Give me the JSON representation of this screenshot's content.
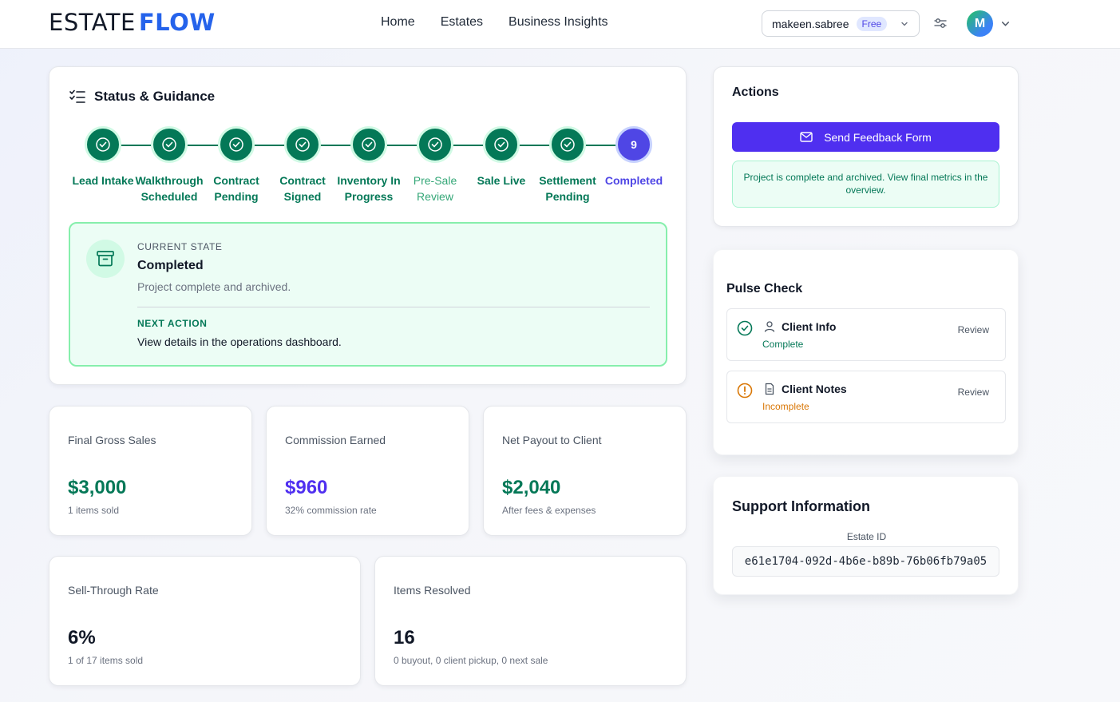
{
  "header": {
    "logo_part1": "ESTATE",
    "logo_part2": "FLOW",
    "nav": [
      "Home",
      "Estates",
      "Business Insights"
    ],
    "username": "makeen.sabree",
    "plan_badge": "Free",
    "avatar_initial": "M"
  },
  "status": {
    "title": "Status & Guidance",
    "steps": [
      {
        "label": "Lead Intake",
        "state": "done"
      },
      {
        "label": "Walkthrough Scheduled",
        "state": "done"
      },
      {
        "label": "Contract Pending",
        "state": "done"
      },
      {
        "label": "Contract Signed",
        "state": "done"
      },
      {
        "label": "Inventory In Progress",
        "state": "done"
      },
      {
        "label": "Pre-Sale Review",
        "state": "done-light"
      },
      {
        "label": "Sale Live",
        "state": "done"
      },
      {
        "label": "Settlement Pending",
        "state": "done"
      },
      {
        "label": "Completed",
        "state": "current",
        "number": "9"
      }
    ],
    "current_state_eyebrow": "CURRENT STATE",
    "current_state_title": "Completed",
    "current_state_desc": "Project complete and archived.",
    "next_action_eyebrow": "NEXT ACTION",
    "next_action_text": "View details in the operations dashboard."
  },
  "metrics": [
    {
      "label": "Final Gross Sales",
      "value": "$3,000",
      "sub": "1 items sold",
      "color": "#047857"
    },
    {
      "label": "Commission Earned",
      "value": "$960",
      "sub": "32% commission rate",
      "color": "#4f2ff0"
    },
    {
      "label": "Net Payout to Client",
      "value": "$2,040",
      "sub": "After fees & expenses",
      "color": "#047857"
    },
    {
      "label": "Sell-Through Rate",
      "value": "6%",
      "sub": "1 of 17 items sold",
      "color": "#111827"
    },
    {
      "label": "Items Resolved",
      "value": "16",
      "sub": "0 buyout, 0 client pickup, 0 next sale",
      "color": "#111827"
    }
  ],
  "actions": {
    "title": "Actions",
    "send_button": "Send Feedback Form",
    "notice": "Project is complete and archived. View final metrics in the overview."
  },
  "pulse": {
    "title": "Pulse Check",
    "items": [
      {
        "title": "Client Info",
        "status": "Complete",
        "review": "Review",
        "status_color": "#047857"
      },
      {
        "title": "Client Notes",
        "status": "Incomplete",
        "review": "Review",
        "status_color": "#d97706"
      }
    ]
  },
  "support": {
    "title": "Support Information",
    "estate_id_label": "Estate ID",
    "estate_id": "e61e1704-092d-4b6e-b89b-76b06fb79a05"
  },
  "colors": {
    "primary": "#4f2ff0",
    "success": "#047857",
    "warning": "#d97706"
  }
}
